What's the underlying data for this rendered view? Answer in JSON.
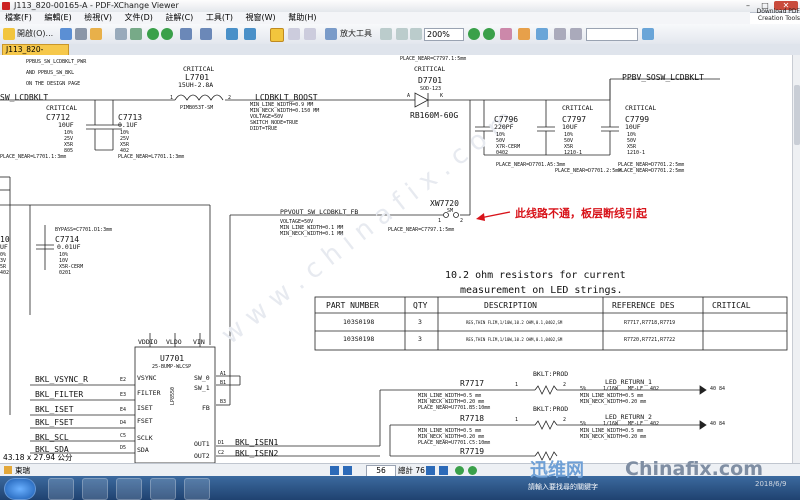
{
  "window": {
    "title": "J113_820-00165-A - PDF-XChange Viewer",
    "min": "–",
    "max": "□",
    "close": "✕"
  },
  "menu": [
    "檔案(F)",
    "編輯(E)",
    "檢視(V)",
    "文件(D)",
    "註解(C)",
    "工具(T)",
    "視窗(W)",
    "幫助(H)"
  ],
  "logo": {
    "line1": "Download PDF",
    "line2": "Creation Tools"
  },
  "toolbar": {
    "open_label": "開啟(O)...",
    "zoom_tool": "放大工具",
    "zoom_value": "200%"
  },
  "tab": {
    "label": "J113_820-00165-A"
  },
  "status": {
    "size": "43.18 x 27.94 公分",
    "page": "56",
    "total": "總計 76",
    "tab_label": "東瑞"
  },
  "schematic": {
    "top_notes": [
      "PPBUS_SW_LCDBKLT_PWR",
      "AND PPBUS_SW_BKL",
      "ON THE DESIGN PAGE"
    ],
    "top_right_net": "PLACE_NEAR=C7797.1:5mm",
    "net_left": "SW_LCDBKLT",
    "l7701": {
      "crit": "CRITICAL",
      "ref": "L7701",
      "val": "15UH-2.8A",
      "pkg": "PIMB053T-SM",
      "pin1": "1",
      "pin2": "2"
    },
    "d7701": {
      "crit": "CRITICAL",
      "ref": "D7701",
      "pkg": "SOD-123",
      "val": "RB160M-60G",
      "pinA": "A",
      "pinK": "K"
    },
    "net_boost": "LCDBKLT_BOOST",
    "boost_props": [
      "MIN_LINE_WIDTH=0.9 MM",
      "MIN_NECK_WIDTH=0.150 MM",
      "VOLTAGE=50V",
      "SWITCH_NODE=TRUE",
      "DIDT=TRUE"
    ],
    "net_ppbv": "PPBV_SOSW_LCDBKLT",
    "c7712": {
      "crit": "CRITICAL",
      "ref": "C7712",
      "val": "10UF",
      "spec": [
        "10%",
        "25V",
        "X5R",
        "805"
      ]
    },
    "c7713": {
      "ref": "C7713",
      "val": "0.1UF",
      "spec": [
        "10%",
        "25V",
        "X5R",
        "402"
      ]
    },
    "c7796": {
      "ref": "C7796",
      "val": "220PF",
      "spec": [
        "10%",
        "50V",
        "X7R-CERM",
        "0402"
      ]
    },
    "c7797": {
      "crit": "CRITICAL",
      "ref": "C7797",
      "val": "10UF",
      "spec": [
        "10%",
        "50V",
        "X5R",
        "1210-1"
      ]
    },
    "c7799": {
      "crit": "CRITICAL",
      "ref": "C7799",
      "val": "10UF",
      "spec": [
        "10%",
        "50V",
        "X5R",
        "1210-1"
      ]
    },
    "place_l": "PLACE_NEAR=L7701.1:3mm",
    "place_l2": "PLACE_NEAR=L7701.1:3mm",
    "place_c7796": "PLACE_NEAR=D7701.A5:3mm",
    "place_d": "PLACE_NEAR=D7701.2:5mm",
    "place_d2": "PLACE_NEAR=D7701.2:5mm",
    "place_d3": "PLACE_NEAR=D7701.2:5mm",
    "xw7720": {
      "ref": "XW7720",
      "pkg": "SM",
      "p1": "1",
      "p2": "2"
    },
    "net_fb": "PPVOUT_SW_LCDBKLT_FB",
    "fb_props": [
      "VOLTAGE=50V",
      "MIN_LINE_WIDTH=0.1 MM",
      "MIN_NECK_WIDTH=0.1 MM"
    ],
    "place_fb": "PLACE_NEAR=C7797.1:5mm",
    "annotation": "此线路不通，板层断线引起",
    "bypass": "BYPASS=C7701.D1:3mm",
    "c7714": {
      "ref": "C7714",
      "val": "0.01UF",
      "spec": [
        "10%",
        "10V",
        "X5R-CERM",
        "0201"
      ]
    },
    "c_left": {
      "ref": "10",
      "val": "UF",
      "spec": [
        "0%",
        "3V",
        "5R",
        "402"
      ]
    },
    "note_line1": "10.2 ohm resistors for current",
    "note_line2": "measurement on LED strings.",
    "table": {
      "headers": [
        "PART NUMBER",
        "QTY",
        "DESCRIPTION",
        "REFERENCE DES",
        "CRITICAL"
      ],
      "rows": [
        [
          "103S0198",
          "3",
          "RES,THIN FLIM,1/10W,10.2 OHM,0.1,0402,SM",
          "R7717,R7718,R7719",
          ""
        ],
        [
          "103S0198",
          "3",
          "RES,THIN FLIM,1/10W,10.2 OHM,0.1,0402,SM",
          "R7720,R7721,R7722",
          ""
        ]
      ]
    },
    "u7701": {
      "ref": "U7701",
      "pkg": "25-BUMP-WLCSP",
      "body": "LP8550",
      "top_pins": [
        "VDDIO",
        "VLDO",
        "VIN"
      ],
      "left_pins": [
        "VSYNC",
        "FILTER",
        "ISET",
        "FSET",
        "SCLK",
        "SDA"
      ],
      "left_nums": [
        "E2",
        "E3",
        "E4",
        "D4",
        "C5",
        "D5"
      ],
      "right_pins": [
        "SW_0",
        "SW_1",
        "FB",
        "OUT1",
        "OUT2"
      ],
      "right_nums": [
        "A1",
        "B1",
        "B3",
        "D1",
        "C2"
      ]
    },
    "left_nets": [
      "BKL_VSYNC_R",
      "BKL_FILTER",
      "BKL_ISET",
      "BKL_FSET",
      "BKL_SCL",
      "BKL_SDA"
    ],
    "isen_nets": [
      "BKL_ISEN1",
      "BKL_ISEN2"
    ],
    "resistors": [
      {
        "ref": "R7717",
        "p1": "1",
        "p2": "2",
        "prod": "BKLT:PROD",
        "props": [
          "MIN_LINE_WIDTH=0.5 mm",
          "MIN_NECK_WIDTH=0.20 mm",
          "PLACE_NEAR=U7701.B5:10mm"
        ],
        "spec": [
          "5%",
          "1/16W",
          "MF-LF",
          "402"
        ],
        "net": "LED_RETURN_1",
        "lprops": [
          "MIN_LINE_WIDTH=0.5 mm",
          "MIN_NECK_WIDTH=0.20 mm"
        ],
        "pins": "40  84"
      },
      {
        "ref": "R7718",
        "p1": "1",
        "p2": "2",
        "prod": "BKLT:PROD",
        "props": [
          "MIN_LINE_WIDTH=0.5 mm",
          "MIN_NECK_WIDTH=0.20 mm",
          "PLACE_NEAR=U7701.C5:10mm"
        ],
        "spec": [
          "5%",
          "1/16W",
          "MF-LF",
          "402"
        ],
        "net": "LED_RETURN_2",
        "lprops": [
          "MIN_LINE_WIDTH=0.5 mm",
          "MIN_NECK_WIDTH=0.20 mm"
        ],
        "pins": "40  84"
      },
      {
        "ref": "R7719"
      }
    ]
  },
  "watermark": {
    "cn": "迅维网",
    "en": "Chinafix.com",
    "date": "2018/6/9",
    "diag": "w w w . c h i n a f i x . c o m"
  },
  "taskbar": {
    "ime": "請輸入要找尋的關鍵字"
  }
}
